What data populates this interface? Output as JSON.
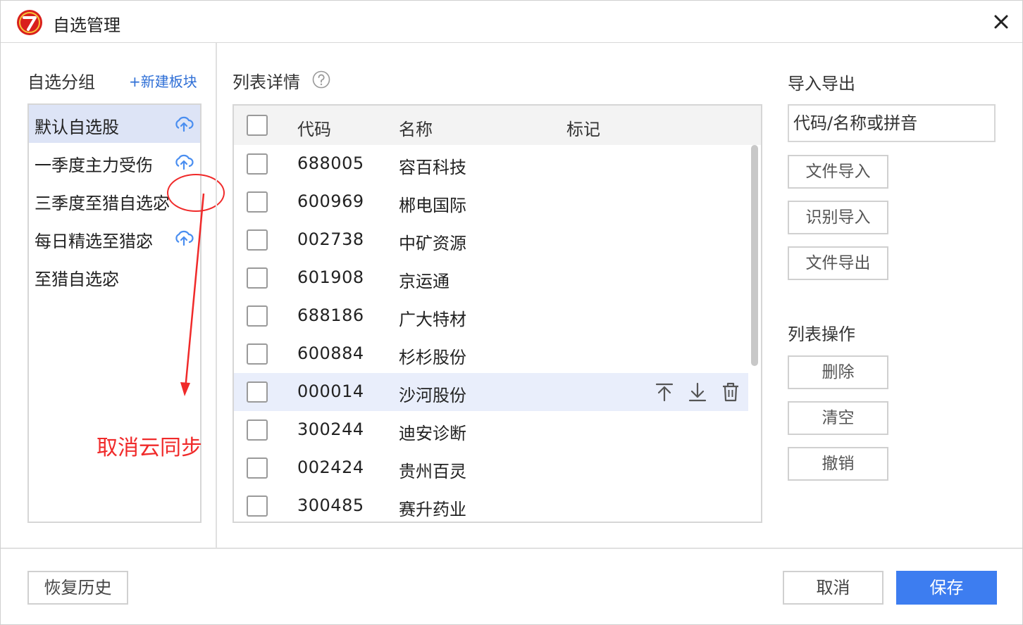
{
  "window": {
    "title": "自选管理",
    "logo_icon": "app-logo-icon",
    "close_icon": "close-icon"
  },
  "groups": {
    "title": "自选分组",
    "new_block_label": "+新建板块",
    "items": [
      {
        "label": "默认自选股",
        "selected": true,
        "cloud_icon": true
      },
      {
        "label": "一季度主力受伤",
        "selected": false,
        "cloud_icon": true
      },
      {
        "label": "三季度至猎自选宓",
        "selected": false,
        "cloud_icon": false
      },
      {
        "label": "每日精选至猎宓",
        "selected": false,
        "cloud_icon": true
      },
      {
        "label": "至猎自选宓",
        "selected": false,
        "cloud_icon": false
      }
    ]
  },
  "annotation": {
    "text": "取消云同步",
    "color": "#f02a2a"
  },
  "list": {
    "title": "列表详情",
    "columns": [
      "代码",
      "名称",
      "标记"
    ],
    "rows": [
      {
        "code": "688005",
        "name": "容百科技"
      },
      {
        "code": "600969",
        "name": "郴电国际"
      },
      {
        "code": "002738",
        "name": "中矿资源"
      },
      {
        "code": "601908",
        "name": "京运通"
      },
      {
        "code": "688186",
        "name": "广大特材"
      },
      {
        "code": "600884",
        "name": "杉杉股份"
      },
      {
        "code": "000014",
        "name": "沙河股份"
      },
      {
        "code": "300244",
        "name": "迪安诊断"
      },
      {
        "code": "002424",
        "name": "贵州百灵"
      },
      {
        "code": "300485",
        "name": "赛升药业"
      }
    ],
    "hover_row_index": 6,
    "row_actions": [
      "move-top-icon",
      "move-down-icon",
      "trash-icon"
    ]
  },
  "import_export": {
    "title": "导入导出",
    "search_placeholder": "代码/名称或拼音",
    "file_import": "文件导入",
    "recognize_import": "识别导入",
    "file_export": "文件导出"
  },
  "list_ops": {
    "title": "列表操作",
    "delete": "删除",
    "clear": "清空",
    "undo": "撤销"
  },
  "footer": {
    "restore_history": "恢复历史",
    "cancel": "取消",
    "save": "保存"
  },
  "colors": {
    "accent": "#3d7df0",
    "selected_bg": "#dde4f6",
    "link": "#2f6fd6"
  }
}
